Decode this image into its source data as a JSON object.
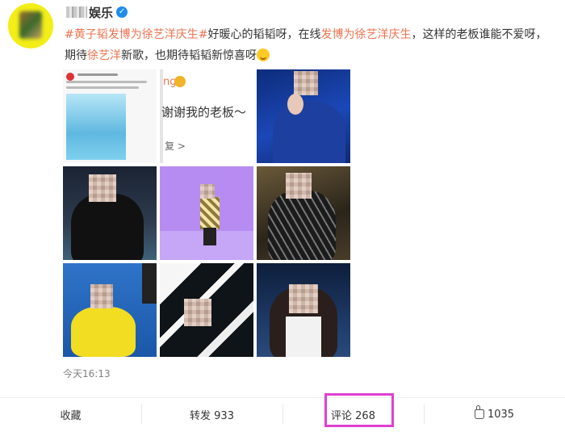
{
  "header": {
    "username": "娱乐",
    "verified_mark": "✓"
  },
  "post": {
    "text_segments": [
      {
        "type": "topic",
        "text": "#黄子韬发博为徐艺洋庆生#"
      },
      {
        "type": "plain",
        "text": "好暖心的韬韬呀，在线"
      },
      {
        "type": "topic",
        "text": "发博为徐艺洋庆生"
      },
      {
        "type": "plain",
        "text": "，这样的老板谁能不爱呀，期待"
      },
      {
        "type": "topic",
        "text": "徐艺洋"
      },
      {
        "type": "plain",
        "text": "新歌，也期待韬韬新惊喜呀"
      }
    ],
    "timestamp": "今天16:13"
  },
  "grid": {
    "image2_line1": "ng",
    "image2_line2": "谢谢我的老板～",
    "image2_line3": "复 >"
  },
  "actions": {
    "favorite": "收藏",
    "repost": "转发 933",
    "comment": "评论 268",
    "like_count": "1035"
  },
  "icons": [
    "verified-icon",
    "emoji-icon",
    "like-icon"
  ],
  "colors": {
    "topic": "#eb7350",
    "highlight_box": "#e040d0",
    "verified": "#1f8ceb"
  }
}
